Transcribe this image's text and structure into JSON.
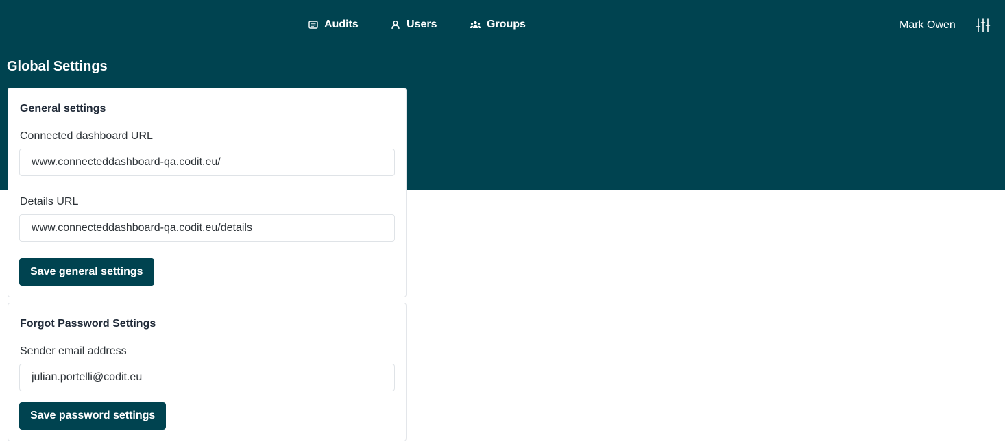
{
  "nav": {
    "items": [
      {
        "label": "Audits",
        "icon": "newspaper-icon"
      },
      {
        "label": "Users",
        "icon": "user-icon"
      },
      {
        "label": "Groups",
        "icon": "users-group-icon"
      }
    ],
    "user_name": "Mark Owen",
    "settings_icon": "sliders-icon"
  },
  "page": {
    "title": "Global Settings"
  },
  "general": {
    "title": "General settings",
    "dashboard_url_label": "Connected dashboard URL",
    "dashboard_url_value": "www.connecteddashboard-qa.codit.eu/",
    "details_url_label": "Details URL",
    "details_url_value": "www.connecteddashboard-qa.codit.eu/details",
    "save_label": "Save general settings"
  },
  "password": {
    "title": "Forgot Password Settings",
    "sender_label": "Sender email address",
    "sender_value": "julian.portelli@codit.eu",
    "save_label": "Save password settings"
  },
  "colors": {
    "primary": "#004350",
    "card_border": "#e3e6ea"
  }
}
